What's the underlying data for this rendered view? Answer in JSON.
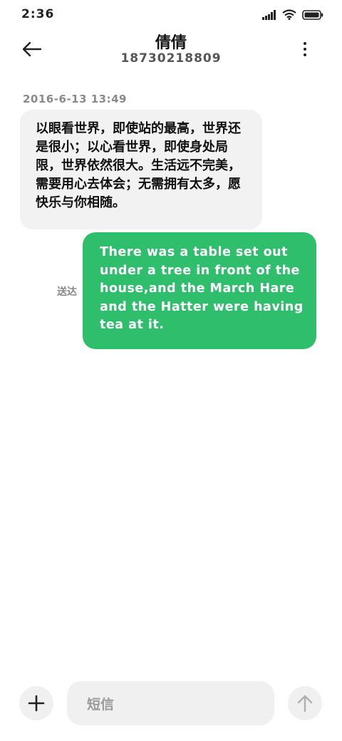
{
  "status_bar": {
    "time": "2:36",
    "icons": [
      "signal-icon",
      "wifi-icon",
      "battery-icon"
    ]
  },
  "header": {
    "contact_name": "倩倩",
    "contact_number": "18730218809"
  },
  "conversation": {
    "timestamp": "2016-6-13 13:49",
    "incoming_message": "以眼看世界，即使站的最高，世界还是很小；以心看世界，即使身处局限，世界依然很大。生活远不完美，需要用心去体会；无需拥有太多，愿快乐与你相随。",
    "outgoing_message": "There was a table set out under a tree in front of the house,and the March Hare and the Hatter were having tea at it.",
    "outgoing_status": "送达"
  },
  "composer": {
    "placeholder": "短信"
  },
  "colors": {
    "outgoing_bubble": "#2fbe6b",
    "incoming_bubble": "#f2f2f2",
    "input_background": "#f0f0f0"
  }
}
